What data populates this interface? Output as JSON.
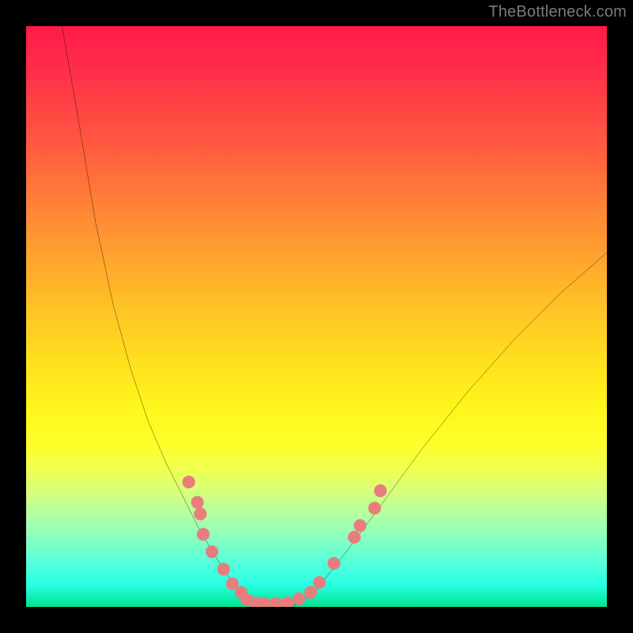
{
  "attribution": "TheBottleneck.com",
  "colors": {
    "frame": "#000000",
    "curve": "#000000",
    "dots": "#e97d7d",
    "attribution_text": "#7a7a7a"
  },
  "chart_data": {
    "type": "line",
    "title": "",
    "xlabel": "",
    "ylabel": "",
    "xlim": [
      0,
      100
    ],
    "ylim": [
      0,
      100
    ],
    "series": [
      {
        "name": "curve-left",
        "x": [
          6,
          9,
          12,
          15,
          18,
          21,
          24,
          27,
          30,
          33,
          35,
          37,
          38,
          39
        ],
        "y": [
          101,
          84,
          66,
          52,
          41,
          32,
          25,
          19,
          13,
          8,
          5,
          2,
          1,
          0.5
        ]
      },
      {
        "name": "curve-bottom",
        "x": [
          39,
          42,
          45,
          47
        ],
        "y": [
          0.5,
          0,
          0,
          0.5
        ]
      },
      {
        "name": "curve-right",
        "x": [
          47,
          50,
          54,
          60,
          68,
          76,
          84,
          92,
          100
        ],
        "y": [
          0.5,
          3,
          8,
          16,
          27,
          37,
          46,
          54,
          61
        ]
      }
    ],
    "dots": [
      {
        "x": 28,
        "y": 21.5
      },
      {
        "x": 29.5,
        "y": 18
      },
      {
        "x": 30,
        "y": 16
      },
      {
        "x": 30.5,
        "y": 12.5
      },
      {
        "x": 32,
        "y": 9.5
      },
      {
        "x": 34,
        "y": 6.5
      },
      {
        "x": 35.5,
        "y": 4
      },
      {
        "x": 37,
        "y": 2.5
      },
      {
        "x": 38,
        "y": 1.2
      },
      {
        "x": 39.5,
        "y": 0.7
      },
      {
        "x": 41,
        "y": 0.6
      },
      {
        "x": 43,
        "y": 0.6
      },
      {
        "x": 45,
        "y": 0.7
      },
      {
        "x": 47,
        "y": 1.4
      },
      {
        "x": 49,
        "y": 2.5
      },
      {
        "x": 50.5,
        "y": 4.2
      },
      {
        "x": 53,
        "y": 7.5
      },
      {
        "x": 56.5,
        "y": 12
      },
      {
        "x": 57.5,
        "y": 14
      },
      {
        "x": 60,
        "y": 17
      },
      {
        "x": 61,
        "y": 20
      }
    ]
  }
}
